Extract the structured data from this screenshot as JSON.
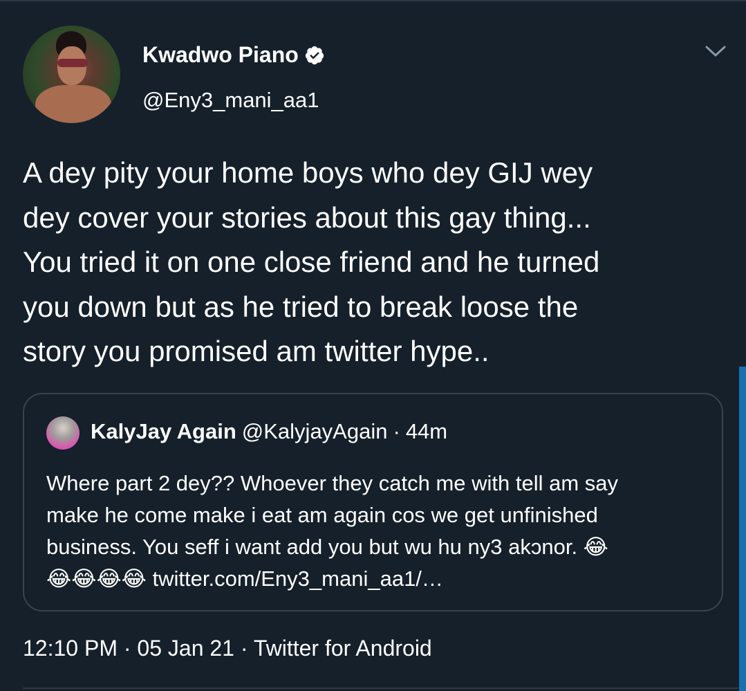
{
  "tweet": {
    "author_name": "Kwadwo Piano",
    "author_handle": "@Eny3_mani_aa1",
    "text": "A dey pity your home boys who dey GIJ wey\ndey cover your stories about this gay thing...\nYou tried it on one close friend and he turned\nyou down but as he tried to break  loose the\nstory you promised am twitter hype..",
    "time": "12:10 PM",
    "date": "05 Jan 21",
    "source": "Twitter for Android"
  },
  "quoted": {
    "author_name": "KalyJay Again",
    "author_handle": "@KalyjayAgain",
    "age": "44m",
    "text": "Where part 2 dey?? Whoever they catch me with tell am say\nmake he come make i eat am again cos we get unfinished\nbusiness. You seff i want add you but wu hu ny3 akɔnor. 😂\n😂😂😂😂 twitter.com/Eny3_mani_aa1/…"
  },
  "icons": {
    "verified": "verified-badge-icon",
    "menu": "chevron-down-icon"
  },
  "colors": {
    "background": "#15202b",
    "border": "#38444d",
    "scrollbar": "#1a6fae"
  }
}
